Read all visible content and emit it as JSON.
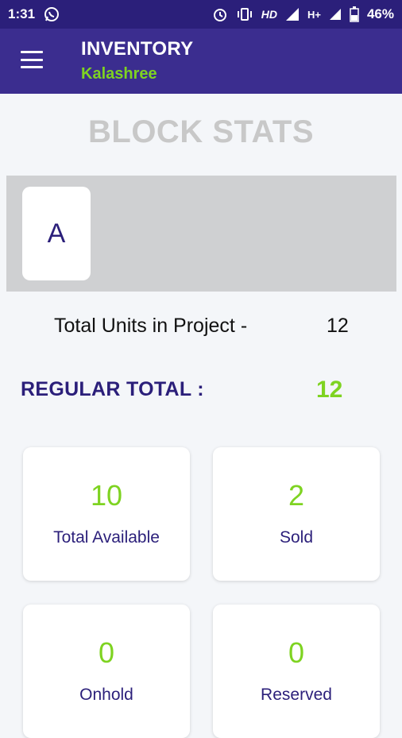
{
  "status_bar": {
    "time": "1:31",
    "network": "HD",
    "signal": "H+",
    "battery": "46%"
  },
  "toolbar": {
    "title": "INVENTORY",
    "subtitle": "Kalashree"
  },
  "page": {
    "section_title": "BLOCK STATS"
  },
  "blocks": [
    {
      "label": "A"
    }
  ],
  "summary": {
    "total_units_label": "Total Units in Project -",
    "total_units_value": "12",
    "regular_total_label": "REGULAR TOTAL :",
    "regular_total_value": "12"
  },
  "stats": [
    {
      "value": "10",
      "label": "Total Available"
    },
    {
      "value": "2",
      "label": "Sold"
    },
    {
      "value": "0",
      "label": "Onhold"
    },
    {
      "value": "0",
      "label": "Reserved"
    }
  ],
  "colors": {
    "status_bar": "#2b1f7a",
    "toolbar": "#3b2d8f",
    "accent_green": "#7ed321",
    "brand_navy": "#2b1f7a"
  }
}
